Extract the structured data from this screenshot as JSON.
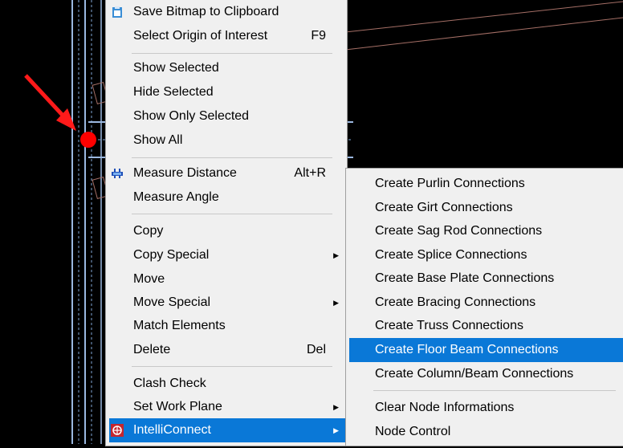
{
  "context_menu": {
    "items": [
      {
        "label": "Save Bitmap to Clipboard",
        "icon": "clipboard-icon"
      },
      {
        "label": "Select Origin of Interest",
        "shortcut": "F9"
      },
      {
        "label": "Show Selected"
      },
      {
        "label": "Hide Selected"
      },
      {
        "label": "Show Only Selected"
      },
      {
        "label": "Show All"
      },
      {
        "label": "Measure Distance",
        "shortcut": "Alt+R",
        "icon": "measure-icon"
      },
      {
        "label": "Measure Angle"
      },
      {
        "label": "Copy"
      },
      {
        "label": "Copy Special"
      },
      {
        "label": "Move"
      },
      {
        "label": "Move Special"
      },
      {
        "label": "Match Elements"
      },
      {
        "label": "Delete",
        "shortcut": "Del"
      },
      {
        "label": "Clash Check"
      },
      {
        "label": "Set Work Plane"
      },
      {
        "label": "IntelliConnect",
        "icon": "intelliconnect-icon",
        "highlighted": true
      }
    ]
  },
  "submenu": {
    "items": [
      {
        "label": "Create Purlin Connections"
      },
      {
        "label": "Create Girt Connections"
      },
      {
        "label": "Create Sag Rod Connections"
      },
      {
        "label": "Create Splice Connections"
      },
      {
        "label": "Create Base Plate Connections"
      },
      {
        "label": "Create Bracing Connections"
      },
      {
        "label": "Create Truss Connections"
      },
      {
        "label": "Create Floor Beam Connections",
        "highlighted": true
      },
      {
        "label": "Create Column/Beam Connections"
      },
      {
        "label": "Clear Node Informations"
      },
      {
        "label": "Node Control"
      }
    ]
  },
  "colors": {
    "highlight": "#0a78d7",
    "menu_bg": "#f0f0f0",
    "drawing_lines": "#7fa6d6",
    "marker": "#ff0000"
  }
}
